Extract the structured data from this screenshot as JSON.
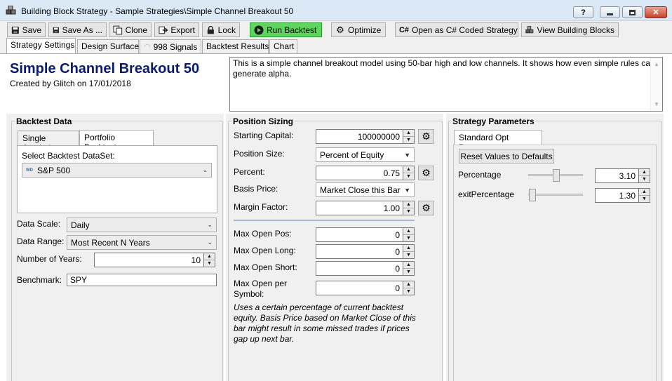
{
  "window": {
    "title": "Building Block Strategy - Sample Strategies\\Simple Channel Breakout 50",
    "help": "?",
    "minimize": "—",
    "maximize": "□",
    "close": "✕"
  },
  "toolbar": {
    "save": "Save",
    "save_as": "Save As ...",
    "clone": "Clone",
    "export": "Export",
    "lock": "Lock",
    "run_backtest": "Run Backtest",
    "optimize": "Optimize",
    "open_csharp": "Open as C# Coded Strategy",
    "view_blocks": "View Building Blocks"
  },
  "tabs": {
    "strategy_settings": "Strategy Settings",
    "design_surface": "Design Surface",
    "signals": "998 Signals",
    "backtest_results": "Backtest Results",
    "chart": "Chart"
  },
  "header": {
    "title": "Simple Channel Breakout 50",
    "subtitle": "Created by Glitch on 17/01/2018",
    "description": "This is a simple channel breakout model using 50-bar high and low channels. It shows how even simple rules can generate alpha."
  },
  "backtest_data": {
    "title": "Backtest Data",
    "tab_single": "Single Symbol",
    "tab_portfolio": "Portfolio Backtest",
    "select_label": "Select Backtest DataSet:",
    "dataset_badge": "WD",
    "dataset": "S&P 500",
    "data_scale_label": "Data Scale:",
    "data_scale": "Daily",
    "data_range_label": "Data Range:",
    "data_range": "Most Recent N Years",
    "years_label": "Number of Years:",
    "years": "10",
    "benchmark_label": "Benchmark:",
    "benchmark": "SPY"
  },
  "position_sizing": {
    "title": "Position Sizing",
    "starting_capital_label": "Starting Capital:",
    "starting_capital": "100000000",
    "position_size_label": "Position Size:",
    "position_size": "Percent of Equity",
    "percent_label": "Percent:",
    "percent": "0.75",
    "basis_price_label": "Basis Price:",
    "basis_price": "Market Close this Bar",
    "margin_factor_label": "Margin Factor:",
    "margin_factor": "1.00",
    "max_open_pos_label": "Max Open Pos:",
    "max_open_pos": "0",
    "max_open_long_label": "Max Open Long:",
    "max_open_long": "0",
    "max_open_short_label": "Max Open Short:",
    "max_open_short": "0",
    "max_open_per_symbol_label_1": "Max Open per",
    "max_open_per_symbol_label_2": "Symbol:",
    "max_open_per_symbol": "0",
    "note": "Uses a certain percentage of current backtest equity. Basis Price based on Market Close of this bar might result in some missed trades if prices gap up next bar."
  },
  "strategy_parameters": {
    "title": "Strategy Parameters",
    "tab": "Standard Opt Params",
    "reset_button": "Reset Values to Defaults",
    "params": [
      {
        "label": "Percentage",
        "value": "3.10",
        "slider_fraction": 0.5
      },
      {
        "label": "exitPercentage",
        "value": "1.30",
        "slider_fraction": 0.0
      }
    ]
  }
}
